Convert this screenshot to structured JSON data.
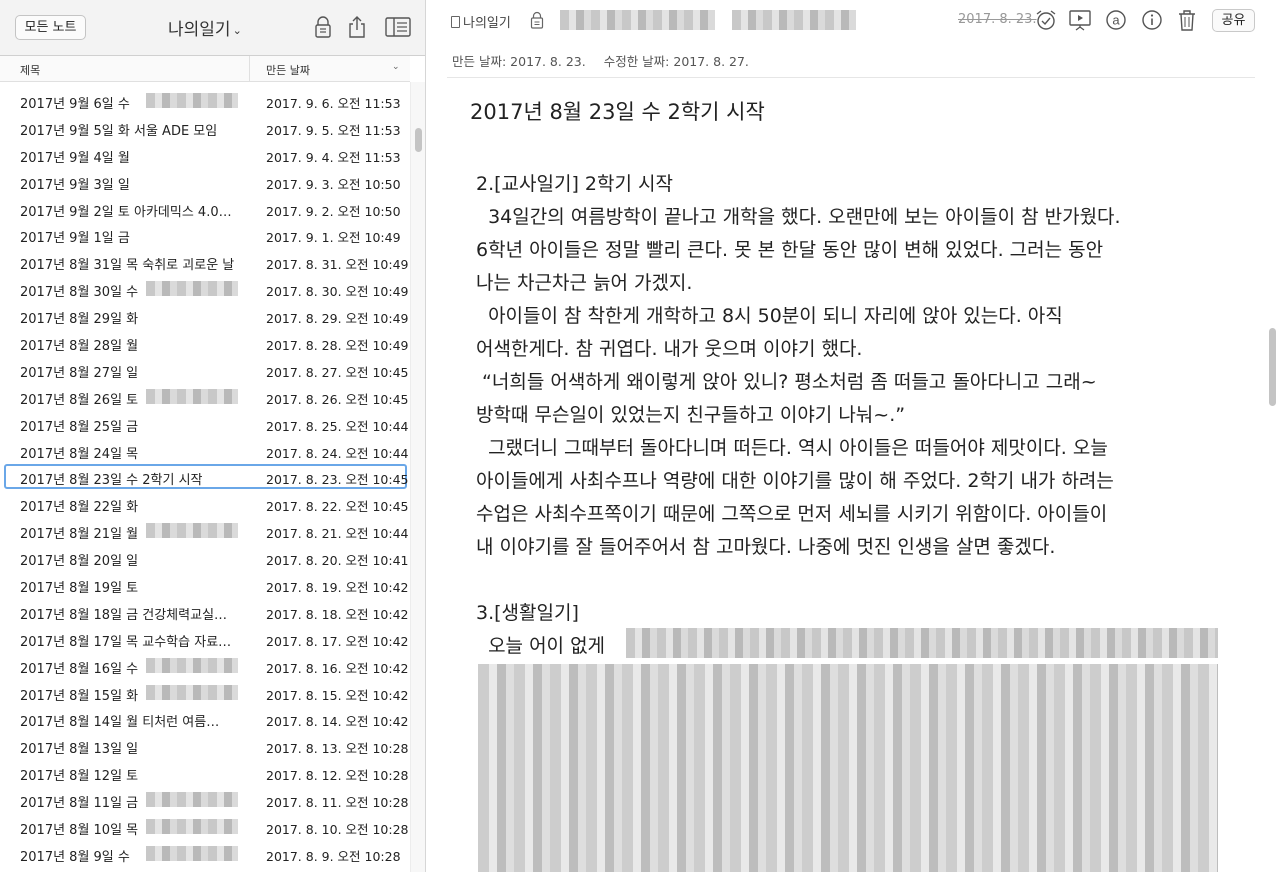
{
  "sidebar": {
    "all_notes_label": "모든 노트",
    "notebook_title": "나의일기",
    "notebook_chevron": "⌄",
    "columns": {
      "title": "제목",
      "created": "만든 날짜",
      "sort_icon": "⌄"
    },
    "notes": [
      {
        "title": "2017년 9월 6일 수 ",
        "date": "2017. 9. 6. 오전 11:53",
        "blur_suffix": true
      },
      {
        "title": "2017년 9월 5일 화 서울 ADE 모임",
        "date": "2017. 9. 5. 오전 11:53"
      },
      {
        "title": "2017년 9월 4일 월",
        "date": "2017. 9. 4. 오전 11:53"
      },
      {
        "title": "2017년 9월 3일 일",
        "date": "2017. 9. 3. 오전 10:50"
      },
      {
        "title": "2017년 9월 2일 토 아카데믹스 4.0…",
        "date": "2017. 9. 2. 오전 10:50"
      },
      {
        "title": "2017년 9월 1일 금",
        "date": "2017. 9. 1. 오전 10:49"
      },
      {
        "title": "2017년 8월 31일 목 숙취로 괴로운 날",
        "date": "2017. 8. 31. 오전 10:49"
      },
      {
        "title": "2017년 8월 30일 수 ",
        "date": "2017. 8. 30. 오전 10:49",
        "blur_suffix": true
      },
      {
        "title": "2017년 8월 29일 화",
        "date": "2017. 8. 29. 오전 10:49"
      },
      {
        "title": "2017년 8월 28일 월",
        "date": "2017. 8. 28. 오전 10:49"
      },
      {
        "title": "2017년 8월 27일 일",
        "date": "2017. 8. 27. 오전 10:45"
      },
      {
        "title": "2017년 8월 26일 토 ",
        "date": "2017. 8. 26. 오전 10:45",
        "blur_suffix": true
      },
      {
        "title": "2017년 8월 25일 금",
        "date": "2017. 8. 25. 오전 10:44"
      },
      {
        "title": "2017년 8월 24일 목",
        "date": "2017. 8. 24. 오전 10:44"
      },
      {
        "title": "2017년 8월 23일 수 2학기 시작",
        "date": "2017. 8. 23. 오전 10:45",
        "selected": true
      },
      {
        "title": "2017년 8월 22일 화",
        "date": "2017. 8. 22. 오전 10:45"
      },
      {
        "title": "2017년 8월 21일 월 ",
        "date": "2017. 8. 21. 오전 10:44",
        "blur_suffix": true
      },
      {
        "title": "2017년 8월 20일 일",
        "date": "2017. 8. 20. 오전 10:41"
      },
      {
        "title": "2017년 8월 19일 토",
        "date": "2017. 8. 19. 오전 10:42"
      },
      {
        "title": "2017년 8월 18일 금 건강체력교실…",
        "date": "2017. 8. 18. 오전 10:42"
      },
      {
        "title": "2017년 8월 17일 목 교수학습 자료…",
        "date": "2017. 8. 17. 오전 10:42"
      },
      {
        "title": "2017년 8월 16일 수 ",
        "date": "2017. 8. 16. 오전 10:42",
        "blur_suffix": true
      },
      {
        "title": "2017년 8월 15일 화 ",
        "date": "2017. 8. 15. 오전 10:42",
        "blur_suffix": true
      },
      {
        "title": "2017년 8월 14일 월 티처런 여름…",
        "date": "2017. 8. 14. 오전 10:42"
      },
      {
        "title": "2017년 8월 13일 일",
        "date": "2017. 8. 13. 오전 10:28"
      },
      {
        "title": "2017년 8월 12일 토",
        "date": "2017. 8. 12. 오전 10:28"
      },
      {
        "title": "2017년 8월 11일 금 ",
        "date": "2017. 8. 11. 오전 10:28",
        "blur_suffix": true
      },
      {
        "title": "2017년 8월 10일 목 ",
        "date": "2017. 8. 10. 오전 10:28",
        "blur_suffix": true
      },
      {
        "title": "2017년 8월 9일 수 ",
        "date": "2017. 8. 9. 오전 10:28",
        "blur_suffix": true
      }
    ]
  },
  "note": {
    "notebook": "나의일기",
    "reminder_date": "2017. 8. 23.",
    "share_label": "공유",
    "created_label": "만든 날짜: 2017. 8. 23.",
    "updated_label": "수정한 날짜: 2017. 8. 27.",
    "title": "2017년 8월 23일 수 2학기 시작",
    "body_lines": [
      "2.[교사일기] 2학기 시작",
      "  34일간의 여름방학이 끝나고 개학을 했다. 오랜만에 보는 아이들이 참 반가웠다.",
      "6학년 아이들은 정말 빨리 큰다. 못 본 한달 동안 많이 변해 있었다. 그러는 동안",
      "나는 차근차근 늙어 가겠지.",
      "  아이들이 참 착한게 개학하고 8시 50분이 되니 자리에 앉아 있는다. 아직",
      "어색한게다. 참 귀엽다. 내가 웃으며 이야기 했다.",
      " “너희들 어색하게 왜이렇게 앉아 있니? 평소처럼 좀 떠들고 돌아다니고 그래~",
      "방학때 무슨일이 있었는지 친구들하고 이야기 나눠~.”",
      "  그랬더니 그때부터 돌아다니며 떠든다. 역시 아이들은 떠들어야 제맛이다. 오늘",
      "아이들에게 사최수프나 역량에 대한 이야기를 많이 해 주었다. 2학기 내가 하려는",
      "수업은 사최수프쪽이기 때문에 그쪽으로 먼저 세뇌를 시키기 위함이다. 아이들이",
      "내 이야기를 잘 들어주어서 참 고마웠다. 나중에 멋진 인생을 살면 좋겠다.",
      "",
      "3.[생활일기]",
      "  오늘 어이 없게"
    ]
  },
  "icons": {
    "lock": "lock-icon",
    "share": "share-icon",
    "layout": "layout-icon",
    "alarm": "alarm-icon",
    "present": "presentation-icon",
    "at": "at-icon",
    "info": "info-icon",
    "trash": "trash-icon"
  }
}
